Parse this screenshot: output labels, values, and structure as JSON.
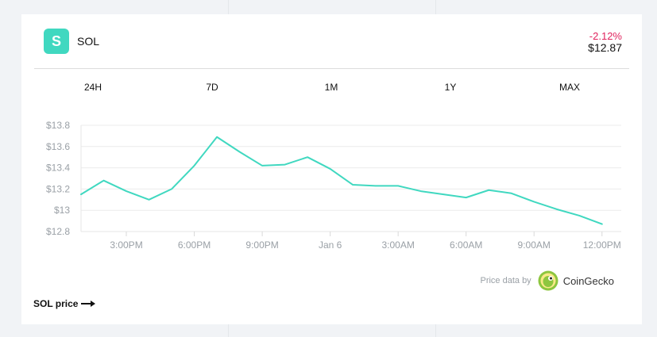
{
  "coin": {
    "logo_letter": "S",
    "name": "SOL",
    "change": "-2.12%",
    "price": "$12.87"
  },
  "tabs": [
    "24H",
    "7D",
    "1M",
    "1Y",
    "MAX"
  ],
  "attribution": {
    "label": "Price data by",
    "provider": "CoinGecko"
  },
  "footer": {
    "link_label": "SOL price"
  },
  "colors": {
    "line": "#40d8c0",
    "accent": "#40d8c0",
    "negative": "#e0245e"
  },
  "chart_data": {
    "type": "line",
    "grid": true,
    "ylim": [
      12.8,
      13.8
    ],
    "yticks": [
      13.8,
      13.6,
      13.4,
      13.2,
      13,
      12.8
    ],
    "ytick_labels": [
      "$13.8",
      "$13.6",
      "$13.4",
      "$13.2",
      "$13",
      "$12.8"
    ],
    "xticks": [
      {
        "x": 2,
        "label": "3:00PM"
      },
      {
        "x": 5,
        "label": "6:00PM"
      },
      {
        "x": 8,
        "label": "9:00PM"
      },
      {
        "x": 11,
        "label": "Jan 6"
      },
      {
        "x": 14,
        "label": "3:00AM"
      },
      {
        "x": 17,
        "label": "6:00AM"
      },
      {
        "x": 20,
        "label": "9:00AM"
      },
      {
        "x": 23,
        "label": "12:00PM"
      }
    ],
    "x_max": 23.85,
    "values": [
      13.15,
      13.28,
      13.18,
      13.1,
      13.2,
      13.42,
      13.69,
      13.55,
      13.42,
      13.43,
      13.5,
      13.39,
      13.24,
      13.23,
      13.23,
      13.18,
      13.15,
      13.12,
      13.19,
      13.16,
      13.08,
      13.01,
      12.95,
      12.87
    ]
  }
}
